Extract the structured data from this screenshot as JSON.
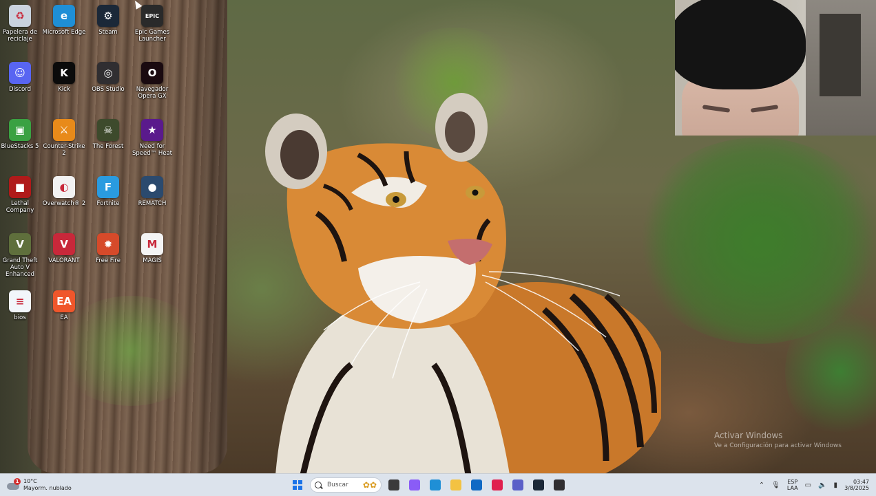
{
  "desktop": {
    "icons": [
      {
        "id": "recycle",
        "label": "Papelera de reciclaje",
        "icon": "recycle-bin-icon",
        "color": "#c9d3de",
        "glyph": "♻"
      },
      {
        "id": "edge",
        "label": "Microsoft Edge",
        "icon": "edge-icon",
        "color": "#1f8fd6",
        "glyph": "e"
      },
      {
        "id": "steam",
        "label": "Steam",
        "icon": "steam-icon",
        "color": "#1b2838",
        "glyph": "⚙"
      },
      {
        "id": "epic",
        "label": "Epic Games Launcher",
        "icon": "epic-games-icon",
        "color": "#2a2a2a",
        "glyph": "EPIC"
      },
      {
        "id": "discord",
        "label": "Discord",
        "icon": "discord-icon",
        "color": "#5865f2",
        "glyph": "☺"
      },
      {
        "id": "kick",
        "label": "Kick",
        "icon": "kick-icon",
        "color": "#0b0b0b",
        "glyph": "K"
      },
      {
        "id": "obs",
        "label": "OBS Studio",
        "icon": "obs-icon",
        "color": "#302e31",
        "glyph": "◎"
      },
      {
        "id": "opera",
        "label": "Navegador Opera GX",
        "icon": "opera-gx-icon",
        "color": "#1a0a10",
        "glyph": "O"
      },
      {
        "id": "bluestacks",
        "label": "BlueStacks 5",
        "icon": "bluestacks-icon",
        "color": "#3aa142",
        "glyph": "▣"
      },
      {
        "id": "cs2",
        "label": "Counter-Strike 2",
        "icon": "counter-strike-icon",
        "color": "#e88a1a",
        "glyph": "⚔"
      },
      {
        "id": "forest",
        "label": "The Forest",
        "icon": "the-forest-icon",
        "color": "#3d4a2c",
        "glyph": "☠"
      },
      {
        "id": "nfs",
        "label": "Need for Speed™ Heat",
        "icon": "need-for-speed-icon",
        "color": "#5a1a8c",
        "glyph": "★"
      },
      {
        "id": "lethal",
        "label": "Lethal Company",
        "icon": "lethal-company-icon",
        "color": "#b01a1a",
        "glyph": "■"
      },
      {
        "id": "overwatch",
        "label": "Overwatch® 2",
        "icon": "overwatch-icon",
        "color": "#f2f2f2",
        "glyph": "◐"
      },
      {
        "id": "fortnite",
        "label": "Fortnite",
        "icon": "fortnite-icon",
        "color": "#2a9be0",
        "glyph": "F"
      },
      {
        "id": "rematch",
        "label": "REMATCH",
        "icon": "rematch-icon",
        "color": "#2b4a6e",
        "glyph": "●"
      },
      {
        "id": "gta",
        "label": "Grand Theft Auto V Enhanced",
        "icon": "gta-v-icon",
        "color": "#5f6f3c",
        "glyph": "V"
      },
      {
        "id": "valorant",
        "label": "VALORANT",
        "icon": "valorant-icon",
        "color": "#c8283a",
        "glyph": "V"
      },
      {
        "id": "freefire",
        "label": "Free Fire",
        "icon": "free-fire-icon",
        "color": "#d64a2a",
        "glyph": "✹"
      },
      {
        "id": "magis",
        "label": "MAGIS",
        "icon": "magis-icon",
        "color": "#f4f4f4",
        "glyph": "M"
      },
      {
        "id": "bios",
        "label": "bios",
        "icon": "bios-file-icon",
        "color": "#f2f6fb",
        "glyph": "≡"
      },
      {
        "id": "ea",
        "label": "EA",
        "icon": "ea-icon",
        "color": "#f0562b",
        "glyph": "EA"
      }
    ]
  },
  "watermark": {
    "title": "Activar Windows",
    "subtitle": "Ve a Configuración para activar Windows"
  },
  "taskbar": {
    "weather": {
      "temp": "10°C",
      "desc": "Mayorm. nublado",
      "alert_count": "1"
    },
    "search_placeholder": "Buscar",
    "apps": [
      {
        "name": "desktop-app",
        "icon": "task-view-icon",
        "color": "#3a3a3a"
      },
      {
        "name": "copilot-app",
        "icon": "copilot-icon",
        "color": "#8a5cf6"
      },
      {
        "name": "edge-app",
        "icon": "edge-icon",
        "color": "#1f8fd6"
      },
      {
        "name": "files-app",
        "icon": "folder-icon",
        "color": "#f3c242"
      },
      {
        "name": "outlook-app",
        "icon": "outlook-icon",
        "color": "#1069c4"
      },
      {
        "name": "opera-app",
        "icon": "opera-gx-icon",
        "color": "#e0204f"
      },
      {
        "name": "teams-app",
        "icon": "teams-icon",
        "color": "#5a5fc8"
      },
      {
        "name": "steam-app",
        "icon": "steam-icon",
        "color": "#1b2838"
      },
      {
        "name": "obs-app",
        "icon": "obs-icon",
        "color": "#302e31"
      }
    ],
    "tray": {
      "lang_top": "ESP",
      "lang_bottom": "LAA",
      "time": "03:47",
      "date": "3/8/2025"
    }
  }
}
